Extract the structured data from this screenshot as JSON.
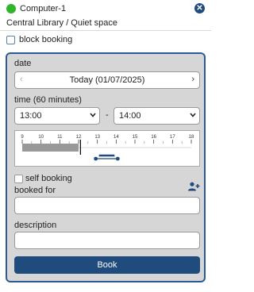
{
  "header": {
    "title": "Computer-1",
    "status_color": "#2fb52a",
    "close_icon": "close-icon",
    "subtitle": "Central Library / Quiet space"
  },
  "block_booking": {
    "label": "block booking",
    "checked": false
  },
  "form": {
    "date_label": "date",
    "date_value": "Today (01/07/2025)",
    "prev_icon": "chevron-left-icon",
    "next_icon": "chevron-right-icon",
    "time_label": "time (60 minutes)",
    "start_time": "13:00",
    "separator": "-",
    "end_time": "14:00",
    "timeline": {
      "hours": [
        "9",
        "10",
        "11",
        "12",
        "13",
        "14",
        "15",
        "16",
        "17",
        "18"
      ],
      "booked_until": 12,
      "now": 12.1,
      "selection_start": 13,
      "selection_end": 14
    },
    "self_booking_label": "self booking",
    "self_booking_checked": false,
    "add_user_icon": "add-user-icon",
    "booked_for_label": "booked for",
    "booked_for_value": "",
    "description_label": "description",
    "description_value": "",
    "book_label": "Book"
  },
  "colors": {
    "accent": "#1f4b7d",
    "panel_border": "#2a5a9a",
    "panel_bg": "#d6d6d6"
  }
}
